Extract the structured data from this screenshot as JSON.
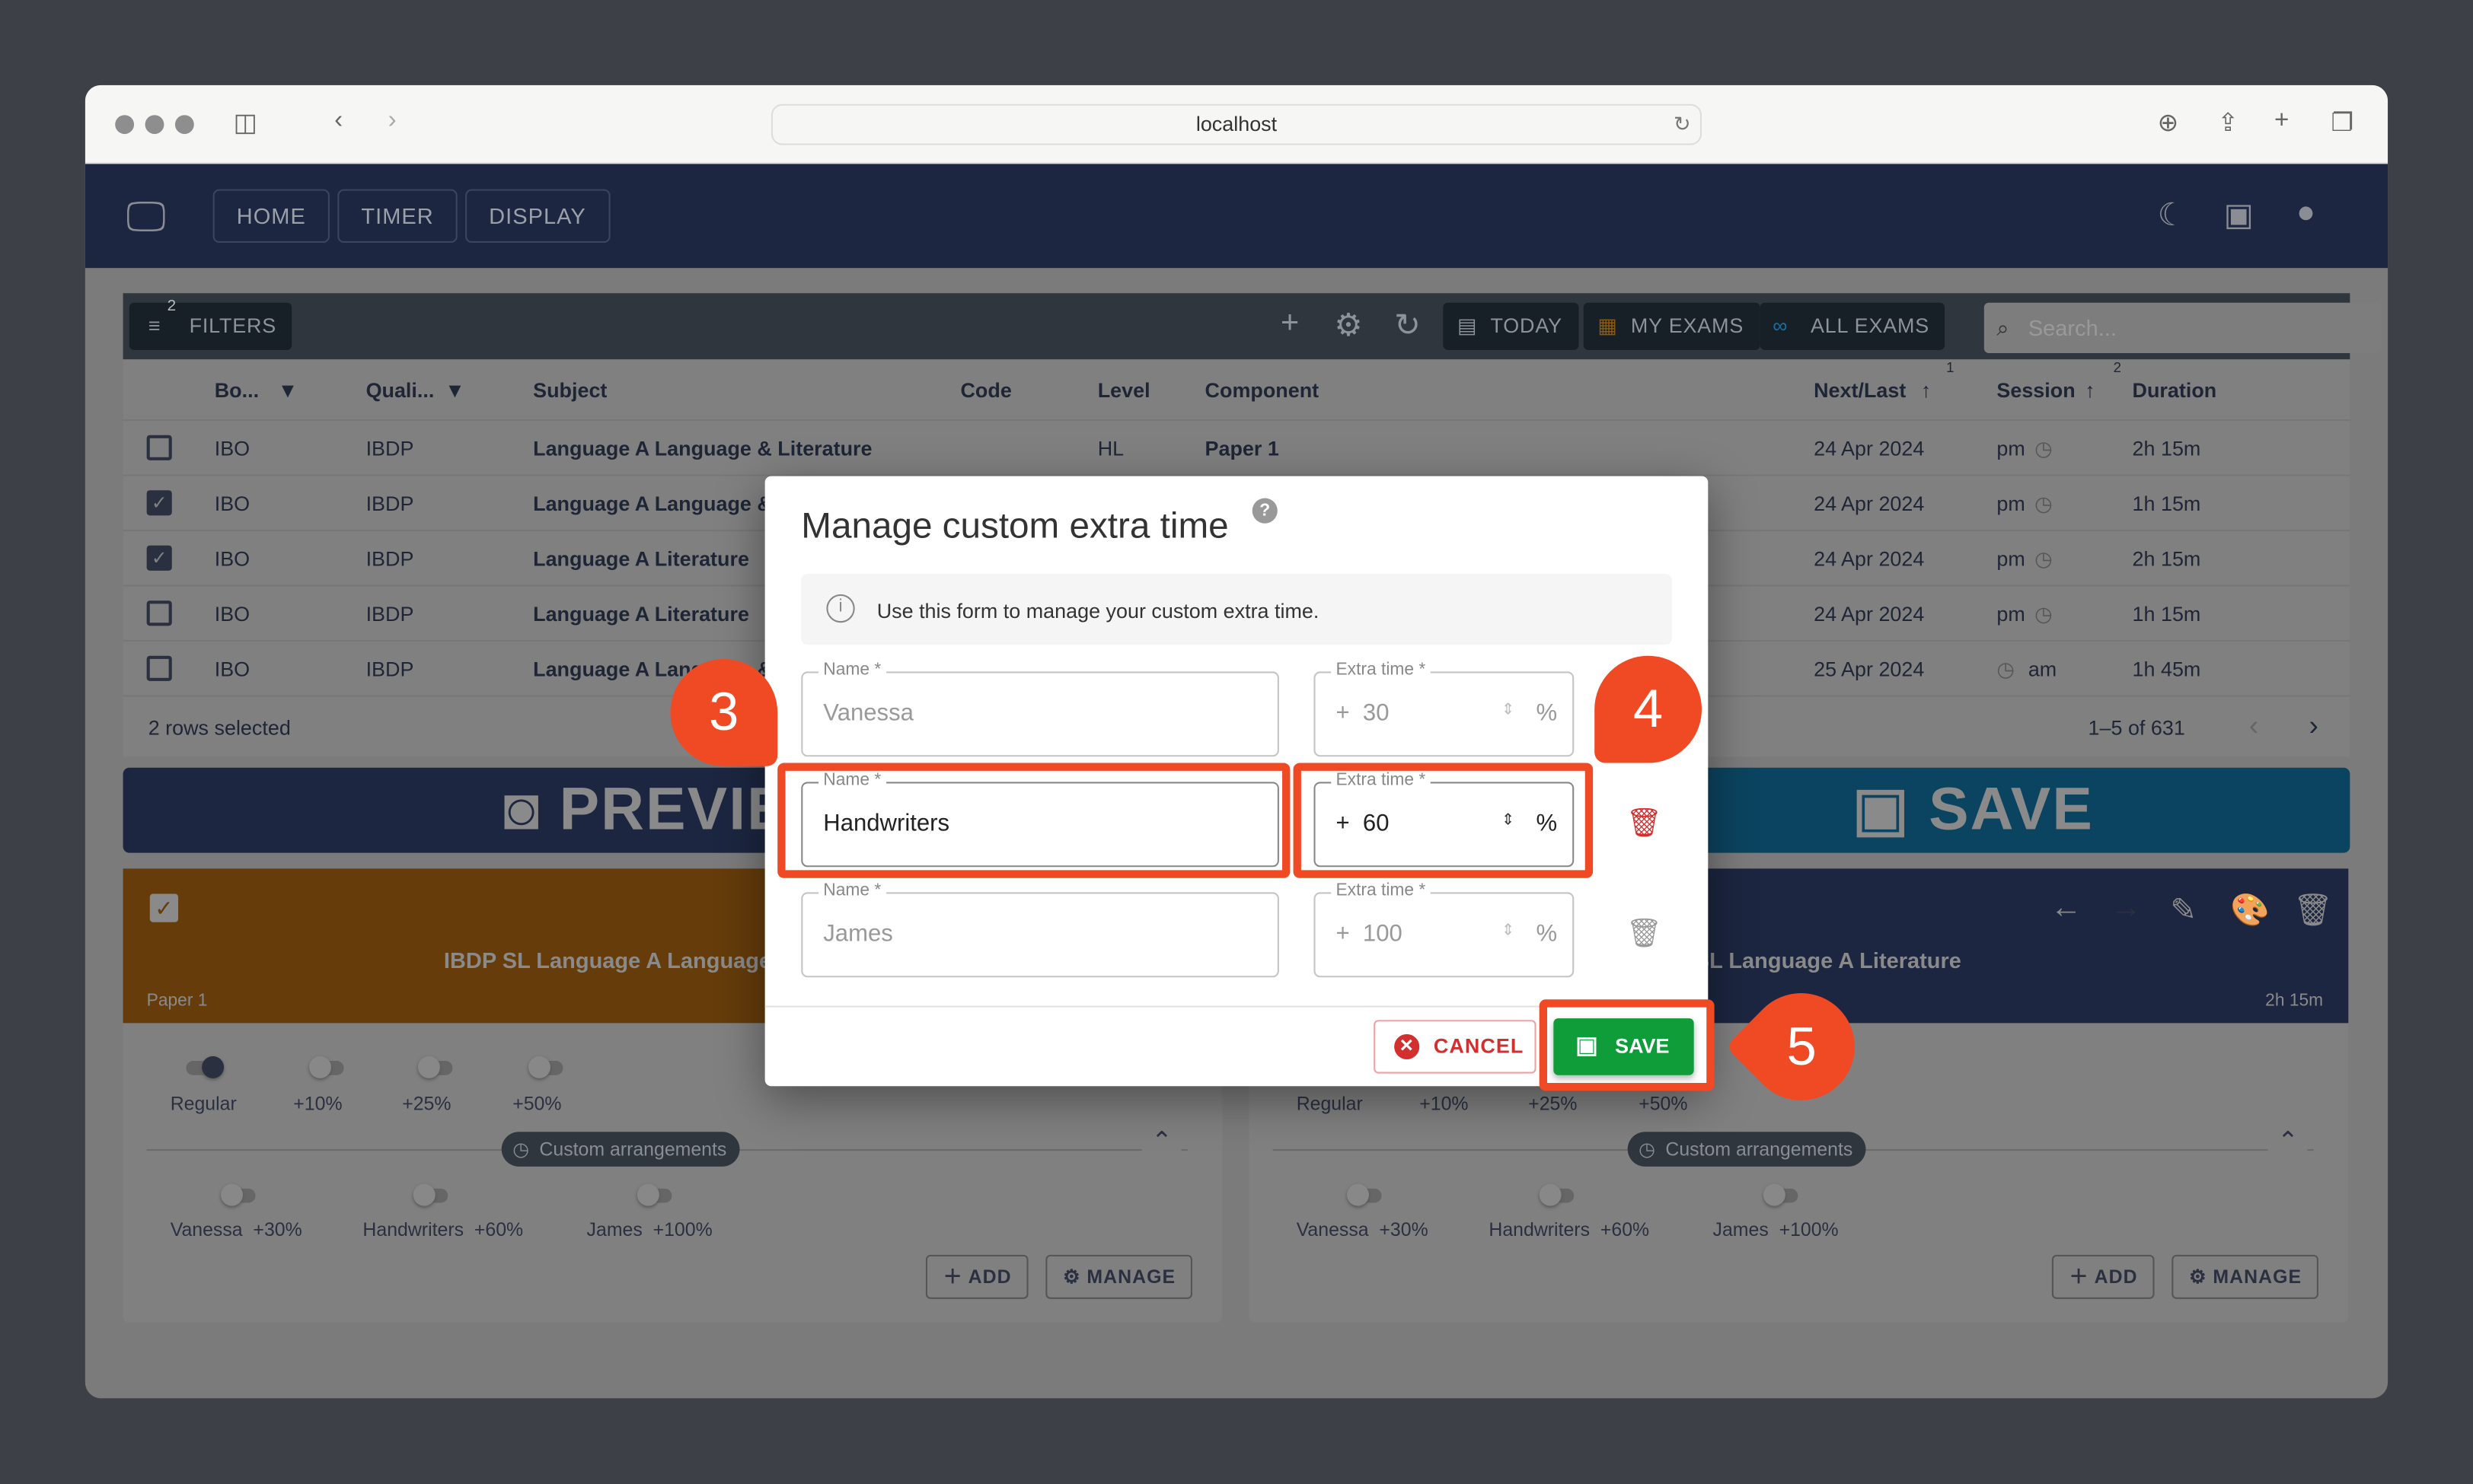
{
  "browser": {
    "url": "localhost"
  },
  "nav": {
    "items": [
      "HOME",
      "TIMER",
      "DISPLAY"
    ]
  },
  "toolbar": {
    "filters_label": "FILTERS",
    "filters_count": "2",
    "today": "TODAY",
    "my_exams": "MY EXAMS",
    "all_exams": "ALL EXAMS",
    "search_placeholder": "Search..."
  },
  "table": {
    "headers": [
      "Bo...",
      "Quali...",
      "Subject",
      "Code",
      "Level",
      "Component",
      "Next/Last",
      "Session",
      "Duration"
    ],
    "sort_indices": {
      "next_last": "1",
      "session": "2"
    },
    "rows": [
      {
        "checked": false,
        "board": "IBO",
        "qual": "IBDP",
        "subject": "Language A Language & Literature",
        "level": "HL",
        "component": "Paper 1",
        "date": "24 Apr 2024",
        "session": "pm",
        "duration": "2h 15m"
      },
      {
        "checked": true,
        "board": "IBO",
        "qual": "IBDP",
        "subject": "Language A Language & Literature",
        "level": "",
        "component": "",
        "date": "24 Apr 2024",
        "session": "pm",
        "duration": "1h 15m"
      },
      {
        "checked": true,
        "board": "IBO",
        "qual": "IBDP",
        "subject": "Language A Literature",
        "level": "",
        "component": "",
        "date": "24 Apr 2024",
        "session": "pm",
        "duration": "2h 15m"
      },
      {
        "checked": false,
        "board": "IBO",
        "qual": "IBDP",
        "subject": "Language A Literature",
        "level": "",
        "component": "",
        "date": "24 Apr 2024",
        "session": "pm",
        "duration": "1h 15m"
      },
      {
        "checked": false,
        "board": "IBO",
        "qual": "IBDP",
        "subject": "Language A Language & Literature",
        "level": "",
        "component": "",
        "date": "25 Apr 2024",
        "session": "am",
        "duration": "1h 45m"
      }
    ],
    "selected_text": "2 rows selected",
    "pagination": "1–5 of 631"
  },
  "preview_button": "PREVIEW",
  "save_big_button": "SAVE",
  "cards": [
    {
      "title": "IBDP SL Language A Language & Literature",
      "component": "Paper 1",
      "duration": "",
      "color": "#653c0a"
    },
    {
      "title": "IBDP SL Language A Literature",
      "component": "",
      "duration": "2h 15m",
      "color": "#1c2640"
    }
  ],
  "extra_time": {
    "options": [
      "Regular",
      "+10%",
      "+25%",
      "+50%"
    ],
    "selected": "Regular",
    "custom_label": "Custom arrangements",
    "custom": [
      {
        "name": "Vanessa",
        "pct": "+30%"
      },
      {
        "name": "Handwriters",
        "pct": "+60%"
      },
      {
        "name": "James",
        "pct": "+100%"
      }
    ],
    "add": "ADD",
    "manage": "MANAGE"
  },
  "modal": {
    "title": "Manage custom extra time",
    "info": "Use this form to manage your custom extra time.",
    "name_label": "Name *",
    "extra_label": "Extra time *",
    "plus": "+",
    "percent": "%",
    "rows": [
      {
        "name": "Vanessa",
        "extra": "30"
      },
      {
        "name": "Handwriters",
        "extra": "60"
      },
      {
        "name": "James",
        "extra": "100"
      }
    ],
    "cancel": "CANCEL",
    "save": "SAVE"
  },
  "annotations": [
    "3",
    "4",
    "5"
  ],
  "colors": {
    "annotation": "#f04a24",
    "save_green": "#0f9d3a",
    "cancel_red": "#d32f2f",
    "header_navy": "#1c2640"
  }
}
